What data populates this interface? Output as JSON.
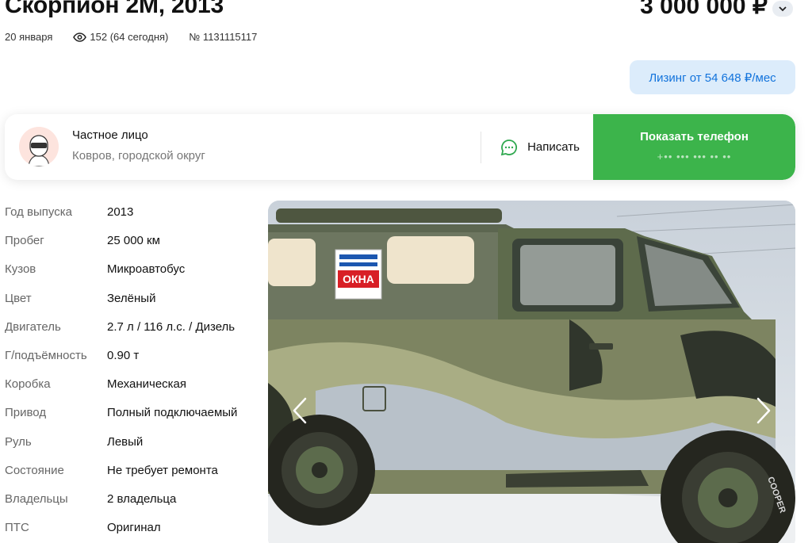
{
  "listing": {
    "title": "Скорпион 2М, 2013",
    "price": "3 000 000 ₽",
    "date": "20 января",
    "views": "152 (64 сегодня)",
    "number": "№ 1131115117"
  },
  "leasing": {
    "label": "Лизинг от 54 648 ₽/мес"
  },
  "seller": {
    "type": "Частное лицо",
    "location": "Ковров, городской округ",
    "write_label": "Написать",
    "phone_label": "Показать телефон",
    "phone_masked": "+•• ••• ••• •• ••"
  },
  "specs": [
    {
      "key": "Год выпуска",
      "value": "2013"
    },
    {
      "key": "Пробег",
      "value": "25 000 км"
    },
    {
      "key": "Кузов",
      "value": "Микроавтобус"
    },
    {
      "key": "Цвет",
      "value": "Зелёный"
    },
    {
      "key": "Двигатель",
      "value": "2.7 л / 116 л.с. / Дизель"
    },
    {
      "key": "Г/подъёмность",
      "value": "0.90 т"
    },
    {
      "key": "Коробка",
      "value": "Механическая"
    },
    {
      "key": "Привод",
      "value": "Полный подключаемый"
    },
    {
      "key": "Руль",
      "value": "Левый"
    },
    {
      "key": "Состояние",
      "value": "Не требует ремонта"
    },
    {
      "key": "Владельцы",
      "value": "2 владельца"
    },
    {
      "key": "ПТС",
      "value": "Оригинал"
    }
  ],
  "gallery": {
    "photo_alt": "camouflage off-road vehicle in snow",
    "sign_text": "ОКНА",
    "tire_text": "COOPER",
    "prev_icon": "chevron-left-icon",
    "next_icon": "chevron-right-icon"
  },
  "colors": {
    "accent_green": "#3cb44b",
    "leasing_bg": "#dcecfb",
    "leasing_text": "#1273dc",
    "chat_icon": "#2fa84f"
  }
}
